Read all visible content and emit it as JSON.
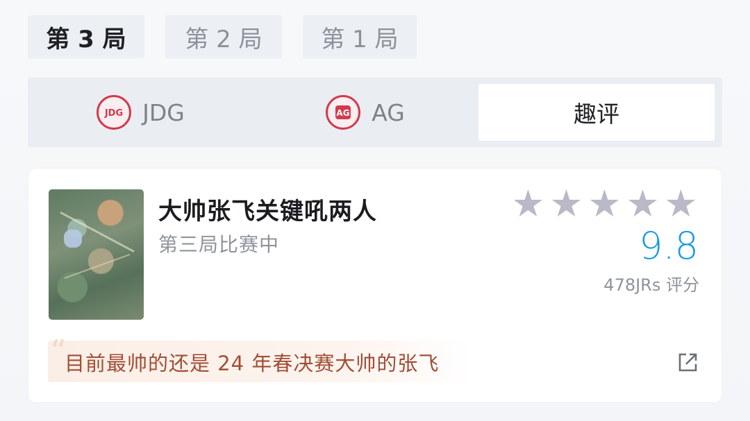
{
  "round_tabs": [
    "第 3 局",
    "第 2 局",
    "第 1 局"
  ],
  "team_tabs": {
    "team1": {
      "logo": "JDG-logo",
      "name": "JDG"
    },
    "team2": {
      "logo": "AG-logo",
      "name": "AG"
    },
    "fun_review": "趣评"
  },
  "card": {
    "title": "大帅张飞关键吼两人",
    "subtitle": "第三局比赛中",
    "rating": {
      "stars_filled": 0,
      "stars_total": 5,
      "score": "9.8",
      "raters": "478JRs 评分"
    },
    "comment": "目前最帅的还是 24 年春决赛大帅的张飞",
    "share_icon": "share-icon"
  },
  "colors": {
    "accent": "#1e9be0",
    "comment_text": "#a14e35",
    "logo": "#d23a4d",
    "star_empty": "#b9b9c7"
  }
}
